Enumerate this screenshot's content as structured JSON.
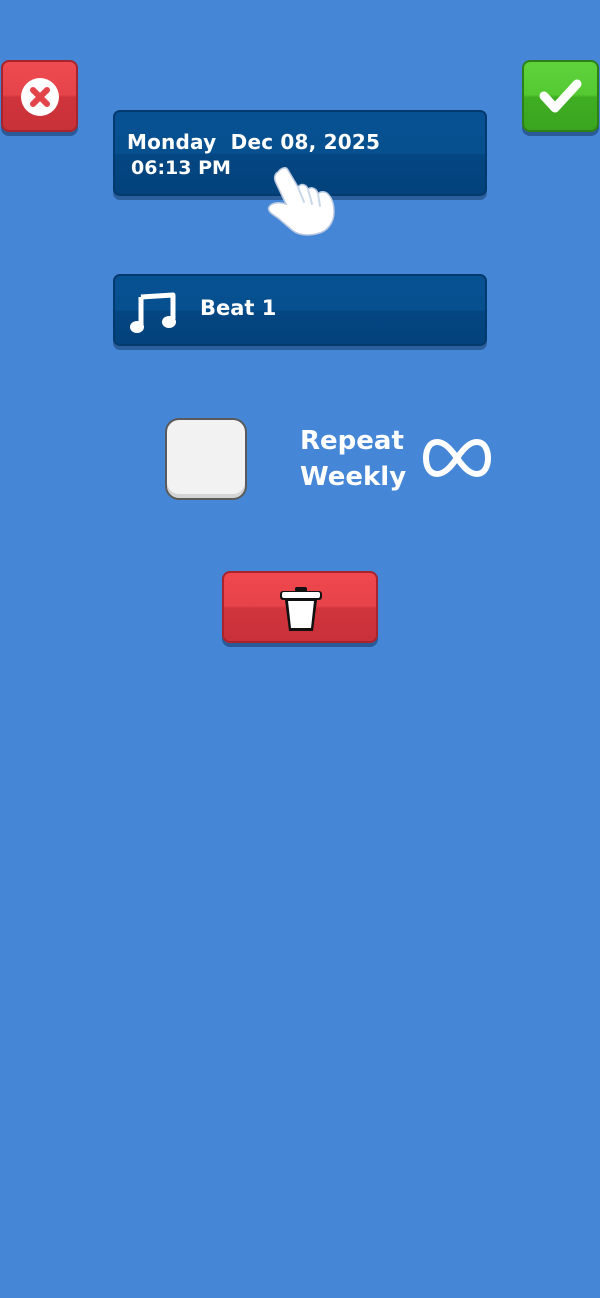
{
  "datetime": {
    "date": "Monday  Dec 08, 2025",
    "time": "06:13 PM"
  },
  "sound": {
    "label": "Beat 1",
    "icon": "music-note-icon"
  },
  "repeat": {
    "line1": "Repeat",
    "line2": "Weekly",
    "checked": false,
    "icon": "infinity-icon"
  },
  "icons": {
    "cancel": "close-icon",
    "confirm": "checkmark-icon",
    "delete": "trash-icon",
    "hint": "pointing-hand-icon"
  },
  "colors": {
    "background": "#4587d6",
    "panel": "#07508f",
    "cancel": "#e4444a",
    "confirm": "#55c931",
    "delete": "#e6434a",
    "text": "#ffffff"
  }
}
